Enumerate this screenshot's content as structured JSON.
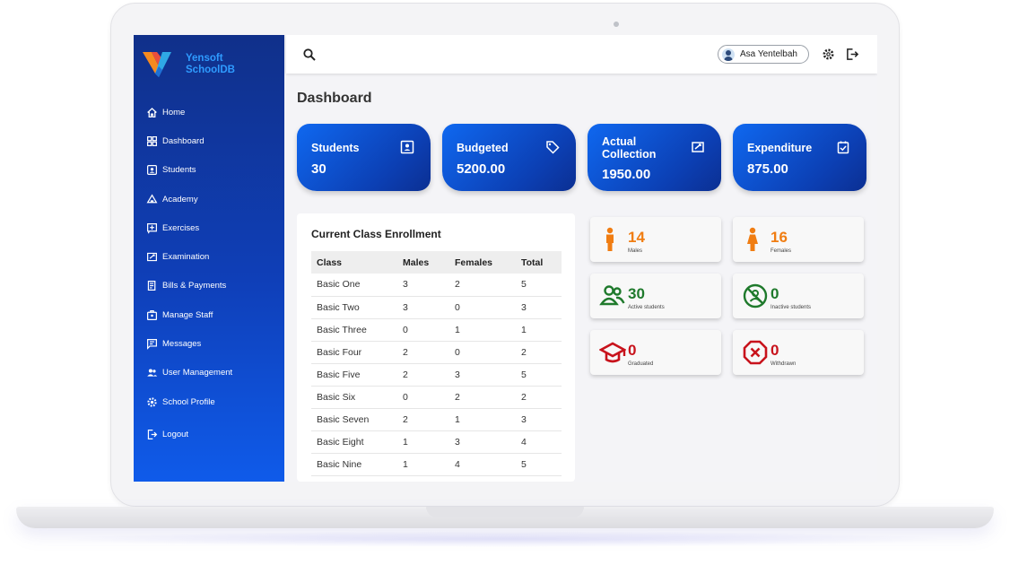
{
  "brand": {
    "name_line1": "Yensoft",
    "name_line2": "SchoolDB"
  },
  "sidebar": {
    "items": [
      {
        "label": "Home",
        "icon": "home-icon"
      },
      {
        "label": "Dashboard",
        "icon": "dashboard-icon"
      },
      {
        "label": "Students",
        "icon": "students-icon"
      },
      {
        "label": "Academy",
        "icon": "academy-icon"
      },
      {
        "label": "Exercises",
        "icon": "exercises-icon"
      },
      {
        "label": "Examination",
        "icon": "examination-icon"
      },
      {
        "label": "Bills & Payments",
        "icon": "bills-icon"
      },
      {
        "label": "Manage Staff",
        "icon": "staff-icon"
      },
      {
        "label": "Messages",
        "icon": "messages-icon"
      },
      {
        "label": "User Management",
        "icon": "users-icon"
      },
      {
        "label": "School Profile",
        "icon": "settings-icon"
      }
    ],
    "logout_label": "Logout"
  },
  "topbar": {
    "user_name": "Asa Yentelbah"
  },
  "page": {
    "title": "Dashboard"
  },
  "stats": [
    {
      "label": "Students",
      "value": "30",
      "icon": "id-card-icon"
    },
    {
      "label": "Budgeted",
      "value": "5200.00",
      "icon": "tag-icon"
    },
    {
      "label": "Actual Collection",
      "value": "1950.00",
      "icon": "cash-icon"
    },
    {
      "label": "Expenditure",
      "value": "875.00",
      "icon": "clipboard-check-icon"
    }
  ],
  "enrollment": {
    "title": "Current Class Enrollment",
    "headers": [
      "Class",
      "Males",
      "Females",
      "Total"
    ],
    "rows": [
      [
        "Basic One",
        "3",
        "2",
        "5"
      ],
      [
        "Basic Two",
        "3",
        "0",
        "3"
      ],
      [
        "Basic Three",
        "0",
        "1",
        "1"
      ],
      [
        "Basic Four",
        "2",
        "0",
        "2"
      ],
      [
        "Basic Five",
        "2",
        "3",
        "5"
      ],
      [
        "Basic Six",
        "0",
        "2",
        "2"
      ],
      [
        "Basic Seven",
        "2",
        "1",
        "3"
      ],
      [
        "Basic Eight",
        "1",
        "3",
        "4"
      ],
      [
        "Basic Nine",
        "1",
        "4",
        "5"
      ]
    ]
  },
  "summary": {
    "males": {
      "value": "14",
      "label": "Males",
      "color": "#f07d12"
    },
    "females": {
      "value": "16",
      "label": "Females",
      "color": "#f07d12"
    },
    "active": {
      "value": "30",
      "label": "Active students",
      "color": "#1f7a2c"
    },
    "inactive": {
      "value": "0",
      "label": "Inactive students",
      "color": "#1f7a2c"
    },
    "graduated": {
      "value": "0",
      "label": "Graduated",
      "color": "#c8131c"
    },
    "withdrawn": {
      "value": "0",
      "label": "Withdrawn",
      "color": "#c8131c"
    }
  }
}
